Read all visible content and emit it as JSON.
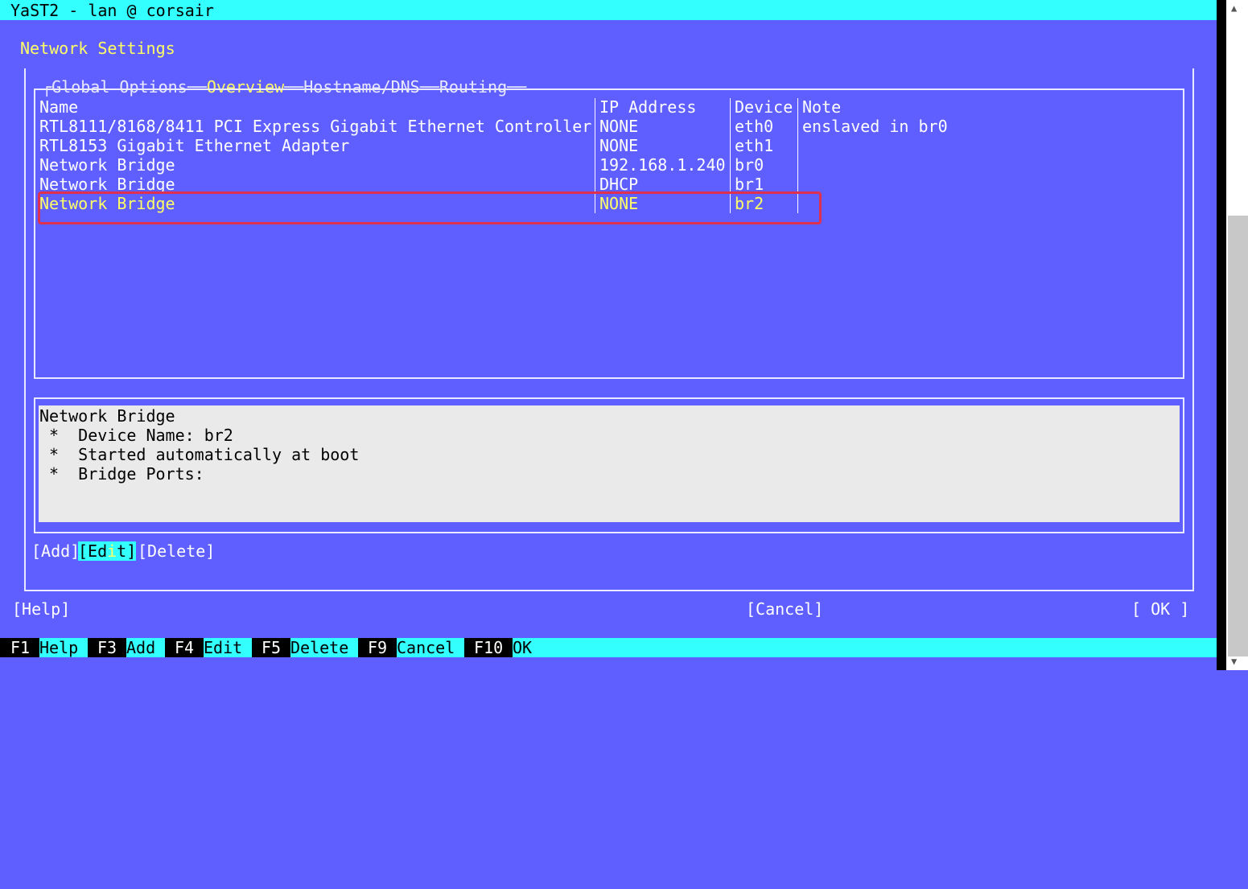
{
  "window": {
    "title": "YaST2 - lan @ corsair"
  },
  "page": {
    "title": "Network Settings"
  },
  "tabs": [
    "Global Options",
    "Overview",
    "Hostname/DNS",
    "Routing"
  ],
  "table": {
    "headers": [
      "Name",
      "IP Address",
      "Device",
      "Note"
    ],
    "rows": [
      {
        "name": "RTL8111/8168/8411 PCI Express Gigabit Ethernet Controller",
        "ip": "NONE",
        "device": "eth0",
        "note": "enslaved in br0"
      },
      {
        "name": "RTL8153 Gigabit Ethernet Adapter",
        "ip": "NONE",
        "device": "eth1",
        "note": ""
      },
      {
        "name": "Network Bridge",
        "ip": "192.168.1.240",
        "device": "br0",
        "note": ""
      },
      {
        "name": "Network Bridge",
        "ip": "DHCP",
        "device": "br1",
        "note": ""
      },
      {
        "name": "Network Bridge",
        "ip": "NONE",
        "device": "br2",
        "note": ""
      }
    ],
    "selected_index": 4
  },
  "details": {
    "title": "Network Bridge",
    "lines": [
      " *  Device Name: br2",
      " *  Started automatically at boot",
      " *  Bridge Ports:"
    ]
  },
  "actions": {
    "add": "[Add]",
    "edit_prefix": "[Ed",
    "edit_hot": "i",
    "edit_suffix": "t]",
    "delete": "[Delete]"
  },
  "footer": {
    "help": "[Help]",
    "cancel": "[Cancel]",
    "ok": "[ OK ]"
  },
  "function_keys": [
    {
      "key": "F1",
      "label": "Help"
    },
    {
      "key": "F3",
      "label": "Add"
    },
    {
      "key": "F4",
      "label": "Edit"
    },
    {
      "key": "F5",
      "label": "Delete"
    },
    {
      "key": "F9",
      "label": "Cancel"
    },
    {
      "key": "F10",
      "label": "OK"
    }
  ],
  "colors": {
    "background": "#5f5fff",
    "accent": "#33ffff",
    "selected_text": "#ffff66",
    "highlight_box": "#e03050"
  }
}
